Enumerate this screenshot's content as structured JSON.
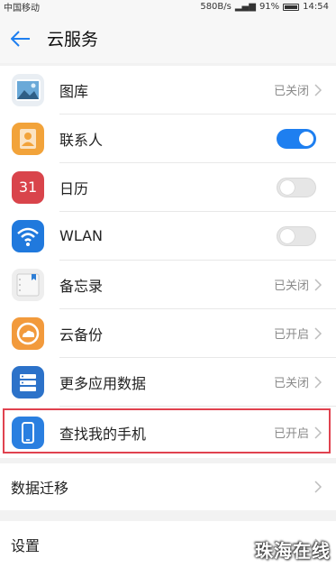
{
  "status_bar": {
    "carrier": "中国移动",
    "speed": "580B/s",
    "battery": "91%",
    "time": "14:54"
  },
  "header": {
    "title": "云服务"
  },
  "items": [
    {
      "label": "图库",
      "status": "已关闭",
      "icon": "gallery-icon"
    },
    {
      "label": "联系人",
      "toggle": "on",
      "icon": "contacts-icon"
    },
    {
      "label": "日历",
      "toggle": "off",
      "icon": "calendar-icon",
      "icon_text": "31"
    },
    {
      "label": "WLAN",
      "toggle": "off",
      "icon": "wifi-icon"
    },
    {
      "label": "备忘录",
      "status": "已关闭",
      "icon": "notepad-icon"
    },
    {
      "label": "云备份",
      "status": "已开启",
      "icon": "cloud-backup-icon"
    },
    {
      "label": "更多应用数据",
      "status": "已关闭",
      "icon": "more-app-data-icon"
    },
    {
      "label": "查找我的手机",
      "status": "已开启",
      "icon": "find-phone-icon"
    }
  ],
  "extra_rows": [
    {
      "label": "数据迁移"
    },
    {
      "label": "设置"
    }
  ],
  "watermark": "珠海在线",
  "colors": {
    "accent": "#1e7ff0",
    "highlight_border": "#e0424f"
  }
}
